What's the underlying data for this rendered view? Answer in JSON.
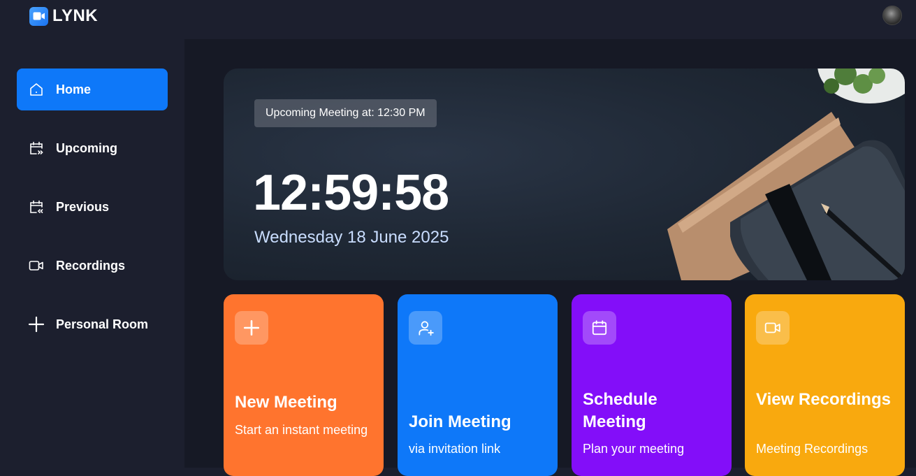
{
  "app": {
    "title": "LYNK"
  },
  "sidebar": {
    "items": [
      {
        "label": "Home",
        "icon": "home-icon",
        "active": true
      },
      {
        "label": "Upcoming",
        "icon": "calendar-forward-icon"
      },
      {
        "label": "Previous",
        "icon": "calendar-back-icon"
      },
      {
        "label": "Recordings",
        "icon": "video-icon"
      },
      {
        "label": "Personal Room",
        "icon": "plus-icon"
      }
    ]
  },
  "hero": {
    "badge": "Upcoming Meeting at: 12:30 PM",
    "time": "12:59:58",
    "date": "Wednesday 18 June 2025"
  },
  "cards": [
    {
      "title": "New Meeting",
      "subtitle": "Start an instant meeting",
      "icon": "plus-icon",
      "color": "#ff742e"
    },
    {
      "title": "Join Meeting",
      "subtitle": "via invitation link",
      "icon": "add-user-icon",
      "color": "#0e78f9"
    },
    {
      "title": "Schedule Meeting",
      "subtitle": "Plan your meeting",
      "icon": "calendar-icon",
      "color": "#830ef9"
    },
    {
      "title": "View Recordings",
      "subtitle": "Meeting Recordings",
      "icon": "video-icon",
      "color": "#f9a90e"
    }
  ],
  "colors": {
    "accent": "#0e78f9",
    "sidebar_bg": "#1c1f2e",
    "main_bg": "#161925"
  }
}
